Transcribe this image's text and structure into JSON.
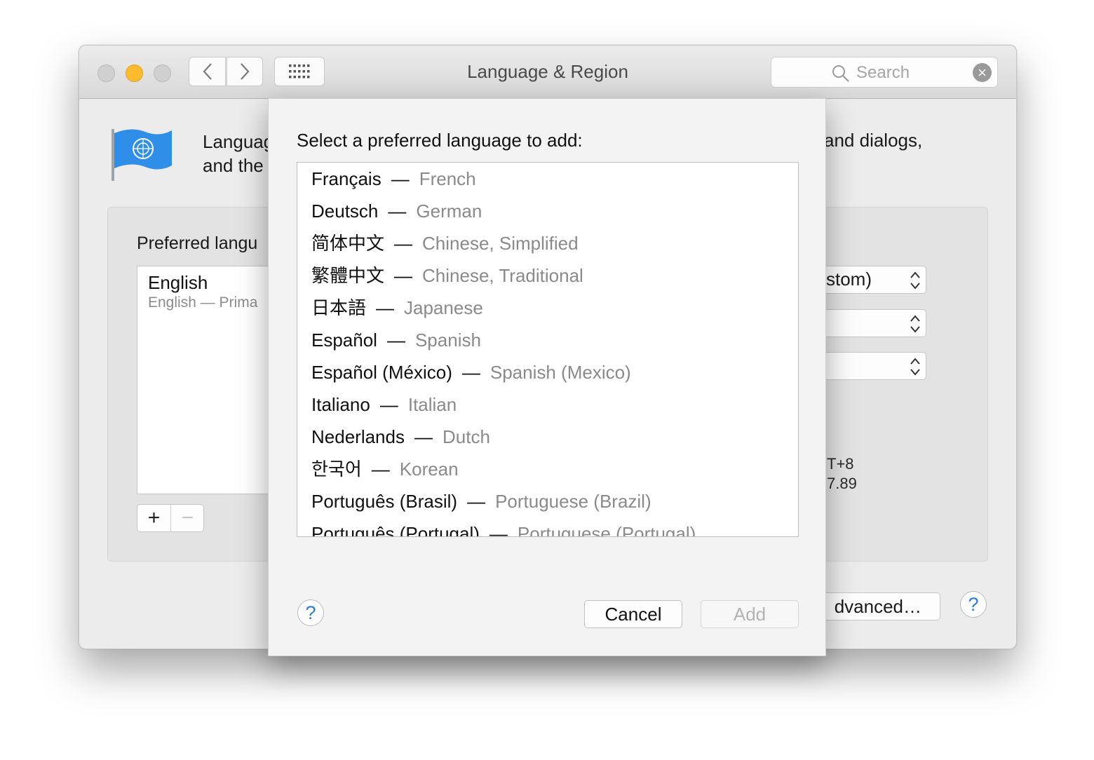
{
  "window": {
    "title": "Language & Region",
    "search_placeholder": "Search"
  },
  "background": {
    "description_line1": "Languag",
    "description_line2": "and the",
    "description_right": "and dialogs,",
    "preferred_label": "Preferred langu",
    "preferred_list": [
      {
        "name": "English",
        "sub": "English — Prima"
      }
    ],
    "popups": [
      "stom)",
      "",
      ""
    ],
    "side_text": [
      "T+8",
      "7.89"
    ],
    "advanced_label": "dvanced…"
  },
  "sheet": {
    "title": "Select a preferred language to add:",
    "languages": [
      {
        "native": "Français",
        "english": "French"
      },
      {
        "native": "Deutsch",
        "english": "German"
      },
      {
        "native": "简体中文",
        "english": "Chinese, Simplified"
      },
      {
        "native": "繁體中文",
        "english": "Chinese, Traditional"
      },
      {
        "native": "日本語",
        "english": "Japanese"
      },
      {
        "native": "Español",
        "english": "Spanish"
      },
      {
        "native": "Español (México)",
        "english": "Spanish (Mexico)"
      },
      {
        "native": "Italiano",
        "english": "Italian"
      },
      {
        "native": "Nederlands",
        "english": "Dutch"
      },
      {
        "native": "한국어",
        "english": "Korean"
      },
      {
        "native": "Português (Brasil)",
        "english": "Portuguese (Brazil)"
      },
      {
        "native": "Português (Portugal)",
        "english": "Portuguese (Portugal)"
      }
    ],
    "separator": "—",
    "cancel_label": "Cancel",
    "add_label": "Add",
    "help_label": "?"
  },
  "colors": {
    "minimize": "#fdbb2d",
    "help_accent": "#2d7de0",
    "secondary_text": "#8a8a8a"
  }
}
